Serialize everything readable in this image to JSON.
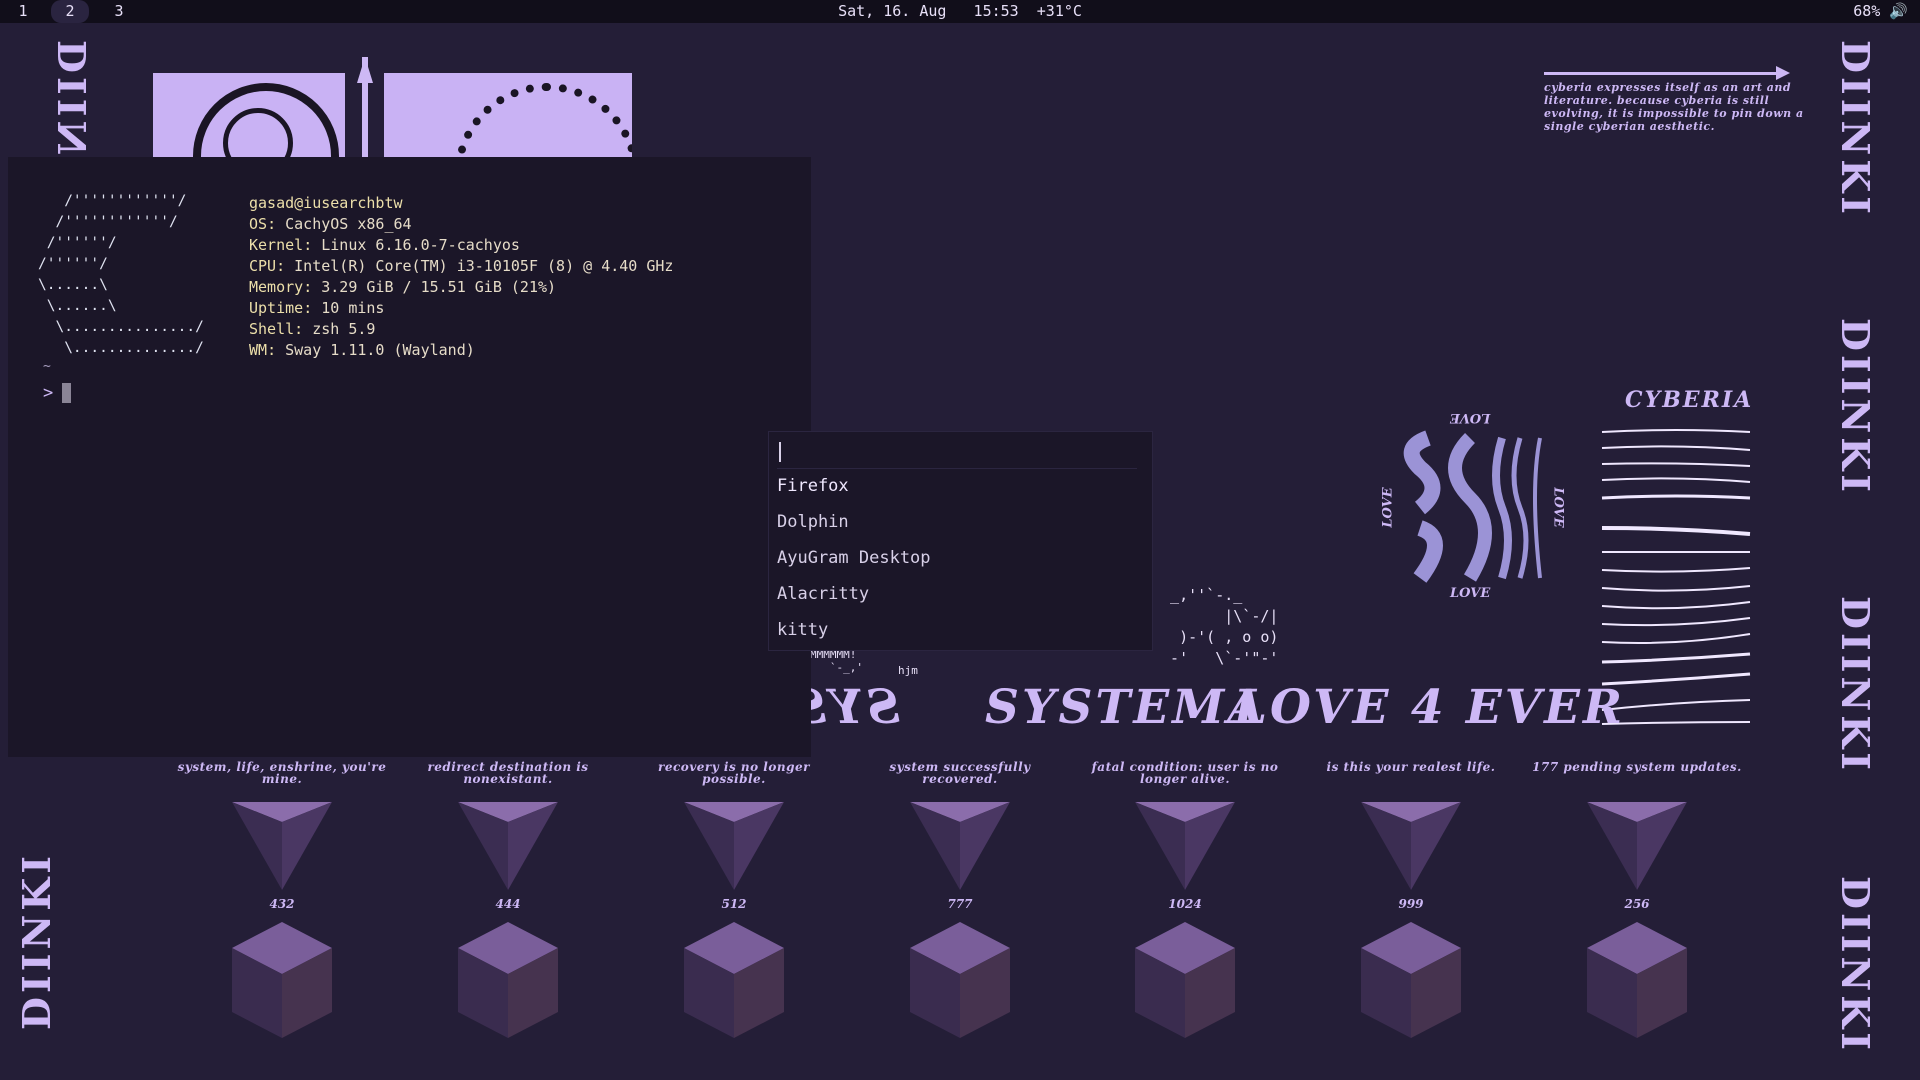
{
  "topbar": {
    "workspaces": [
      "1",
      "2",
      "3"
    ],
    "active_workspace": "2",
    "clock": "Sat, 16. Aug   15:53  +31°C",
    "status": "68% 🔊"
  },
  "wallpaper": {
    "side_text": "DIINKI",
    "quote": "cyberia expresses itself as an art and literature. because cyberia is still evolving, it is impossible to pin down a single cyberian aesthetic.",
    "cyberia_title": "CYBERIA",
    "love_labels": [
      "LOVE",
      "LOVE",
      "LOVE",
      "LOVE"
    ],
    "banner_mirror": "SYSTEMA",
    "banner_1": "SYSTEMA",
    "banner_2": "LOVE 4 EVER",
    "ascii_cat_signature": "hjm",
    "items": [
      {
        "caption": "system, life, enshrine, you're mine.",
        "number": "432"
      },
      {
        "caption": "redirect destination is nonexistant.",
        "number": "444"
      },
      {
        "caption": "recovery is no longer possible.",
        "number": "512"
      },
      {
        "caption": "system successfully recovered.",
        "number": "777"
      },
      {
        "caption": "fatal condition: user is no longer alive.",
        "number": "1024"
      },
      {
        "caption": "is this your realest life.",
        "number": "999"
      },
      {
        "caption": "177 pending system updates.",
        "number": "256"
      }
    ]
  },
  "terminal": {
    "ascii_logo": "   /''''''''''''/\n  /''''''''''''/\n /''''''/\n/''''''/\n\\......\\\n \\......\\\n  \\.............../\n   \\............../",
    "user_host": "gasad@iusearchbtw",
    "info": [
      {
        "label": "OS",
        "value": "CachyOS x86_64"
      },
      {
        "label": "Kernel",
        "value": "Linux 6.16.0-7-cachyos"
      },
      {
        "label": "CPU",
        "value": "Intel(R) Core(TM) i3-10105F (8) @ 4.40 GHz"
      },
      {
        "label": "Memory",
        "value": "3.29 GiB / 15.51 GiB (21%)"
      },
      {
        "label": "Uptime",
        "value": "10 mins"
      },
      {
        "label": "Shell",
        "value": "zsh 5.9"
      },
      {
        "label": "WM",
        "value": "Sway 1.11.0 (Wayland)"
      }
    ],
    "tilde": "~",
    "prompt": ">"
  },
  "launcher": {
    "query": "",
    "items": [
      "Firefox",
      "Dolphin",
      "AyuGram Desktop",
      "Alacritty",
      "kitty"
    ],
    "selected": "Firefox"
  },
  "colors": {
    "background": "#241e37",
    "accent": "#cdb8f5",
    "terminal_bg": "#1b1628",
    "bar_bg": "#110e1a"
  }
}
